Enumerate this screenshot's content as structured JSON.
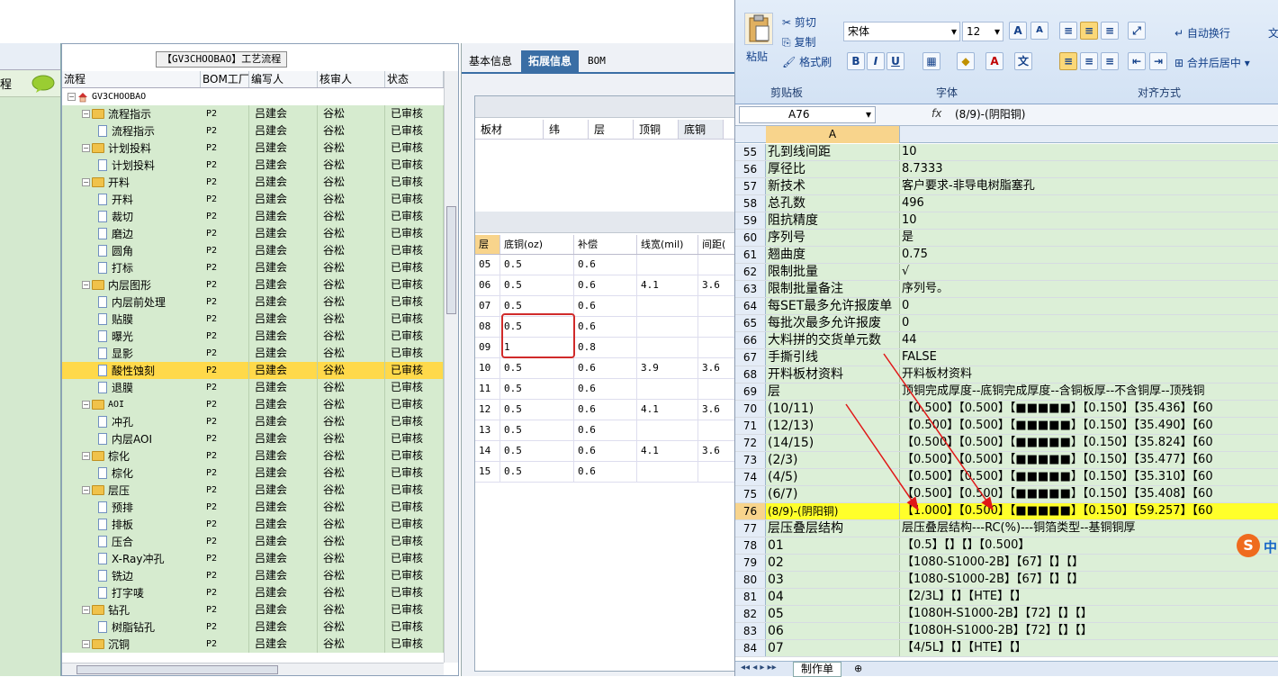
{
  "left_strip": {
    "label": "程"
  },
  "tree": {
    "title": "【GV3CHOOBAO】工艺流程",
    "columns": [
      "流程",
      "BOM工厂",
      "编写人",
      "核审人",
      "状态"
    ],
    "root": "GV3CHOOBAO",
    "rows": [
      {
        "name": "流程指示",
        "level": 1,
        "type": "folder",
        "factory": "P2",
        "author": "吕建会",
        "reviewer": "谷松",
        "status": "已审核"
      },
      {
        "name": "流程指示",
        "level": 2,
        "type": "doc",
        "factory": "P2",
        "author": "吕建会",
        "reviewer": "谷松",
        "status": "已审核"
      },
      {
        "name": "计划投料",
        "level": 1,
        "type": "folder",
        "factory": "P2",
        "author": "吕建会",
        "reviewer": "谷松",
        "status": "已审核"
      },
      {
        "name": "计划投料",
        "level": 2,
        "type": "doc",
        "factory": "P2",
        "author": "吕建会",
        "reviewer": "谷松",
        "status": "已审核"
      },
      {
        "name": "开料",
        "level": 1,
        "type": "folder",
        "factory": "P2",
        "author": "吕建会",
        "reviewer": "谷松",
        "status": "已审核"
      },
      {
        "name": "开料",
        "level": 2,
        "type": "doc",
        "factory": "P2",
        "author": "吕建会",
        "reviewer": "谷松",
        "status": "已审核"
      },
      {
        "name": "裁切",
        "level": 2,
        "type": "doc",
        "factory": "P2",
        "author": "吕建会",
        "reviewer": "谷松",
        "status": "已审核"
      },
      {
        "name": "磨边",
        "level": 2,
        "type": "doc",
        "factory": "P2",
        "author": "吕建会",
        "reviewer": "谷松",
        "status": "已审核"
      },
      {
        "name": "圆角",
        "level": 2,
        "type": "doc",
        "factory": "P2",
        "author": "吕建会",
        "reviewer": "谷松",
        "status": "已审核"
      },
      {
        "name": "打标",
        "level": 2,
        "type": "doc",
        "factory": "P2",
        "author": "吕建会",
        "reviewer": "谷松",
        "status": "已审核"
      },
      {
        "name": "内层图形",
        "level": 1,
        "type": "folder",
        "factory": "P2",
        "author": "吕建会",
        "reviewer": "谷松",
        "status": "已审核"
      },
      {
        "name": "内层前处理",
        "level": 2,
        "type": "doc",
        "factory": "P2",
        "author": "吕建会",
        "reviewer": "谷松",
        "status": "已审核"
      },
      {
        "name": "贴膜",
        "level": 2,
        "type": "doc",
        "factory": "P2",
        "author": "吕建会",
        "reviewer": "谷松",
        "status": "已审核"
      },
      {
        "name": "曝光",
        "level": 2,
        "type": "doc",
        "factory": "P2",
        "author": "吕建会",
        "reviewer": "谷松",
        "status": "已审核"
      },
      {
        "name": "显影",
        "level": 2,
        "type": "doc",
        "factory": "P2",
        "author": "吕建会",
        "reviewer": "谷松",
        "status": "已审核"
      },
      {
        "name": "酸性蚀刻",
        "level": 2,
        "type": "doc",
        "factory": "P2",
        "author": "吕建会",
        "reviewer": "谷松",
        "status": "已审核",
        "selected": true
      },
      {
        "name": "退膜",
        "level": 2,
        "type": "doc",
        "factory": "P2",
        "author": "吕建会",
        "reviewer": "谷松",
        "status": "已审核"
      },
      {
        "name": "AOI",
        "level": 1,
        "type": "folder",
        "factory": "P2",
        "author": "吕建会",
        "reviewer": "谷松",
        "status": "已审核"
      },
      {
        "name": "冲孔",
        "level": 2,
        "type": "doc",
        "factory": "P2",
        "author": "吕建会",
        "reviewer": "谷松",
        "status": "已审核"
      },
      {
        "name": "内层AOI",
        "level": 2,
        "type": "doc",
        "factory": "P2",
        "author": "吕建会",
        "reviewer": "谷松",
        "status": "已审核"
      },
      {
        "name": "棕化",
        "level": 1,
        "type": "folder",
        "factory": "P2",
        "author": "吕建会",
        "reviewer": "谷松",
        "status": "已审核"
      },
      {
        "name": "棕化",
        "level": 2,
        "type": "doc",
        "factory": "P2",
        "author": "吕建会",
        "reviewer": "谷松",
        "status": "已审核"
      },
      {
        "name": "层压",
        "level": 1,
        "type": "folder",
        "factory": "P2",
        "author": "吕建会",
        "reviewer": "谷松",
        "status": "已审核"
      },
      {
        "name": "预排",
        "level": 2,
        "type": "doc",
        "factory": "P2",
        "author": "吕建会",
        "reviewer": "谷松",
        "status": "已审核"
      },
      {
        "name": "排板",
        "level": 2,
        "type": "doc",
        "factory": "P2",
        "author": "吕建会",
        "reviewer": "谷松",
        "status": "已审核"
      },
      {
        "name": "压合",
        "level": 2,
        "type": "doc",
        "factory": "P2",
        "author": "吕建会",
        "reviewer": "谷松",
        "status": "已审核"
      },
      {
        "name": "X-Ray冲孔",
        "level": 2,
        "type": "doc",
        "factory": "P2",
        "author": "吕建会",
        "reviewer": "谷松",
        "status": "已审核"
      },
      {
        "name": "铣边",
        "level": 2,
        "type": "doc",
        "factory": "P2",
        "author": "吕建会",
        "reviewer": "谷松",
        "status": "已审核"
      },
      {
        "name": "打字唛",
        "level": 2,
        "type": "doc",
        "factory": "P2",
        "author": "吕建会",
        "reviewer": "谷松",
        "status": "已审核"
      },
      {
        "name": "钻孔",
        "level": 1,
        "type": "folder",
        "factory": "P2",
        "author": "吕建会",
        "reviewer": "谷松",
        "status": "已审核"
      },
      {
        "name": "树脂钻孔",
        "level": 2,
        "type": "doc",
        "factory": "P2",
        "author": "吕建会",
        "reviewer": "谷松",
        "status": "已审核"
      },
      {
        "name": "沉铜",
        "level": 1,
        "type": "folder",
        "factory": "P2",
        "author": "吕建会",
        "reviewer": "谷松",
        "status": "已审核"
      }
    ]
  },
  "mid": {
    "tabs": [
      "基本信息",
      "拓展信息",
      "BOM"
    ],
    "active_tab": 1,
    "board_columns": [
      "板材",
      "纬",
      "层",
      "顶铜",
      "底铜"
    ],
    "layer_columns": [
      "层",
      "底铜(oz)",
      "补偿",
      "线宽(mil)",
      "间距("
    ],
    "layer_rows": [
      [
        "05",
        "0.5",
        "0.6",
        "",
        ""
      ],
      [
        "06",
        "0.5",
        "0.6",
        "4.1",
        "3.6"
      ],
      [
        "07",
        "0.5",
        "0.6",
        "",
        ""
      ],
      [
        "08",
        "0.5",
        "0.6",
        "",
        ""
      ],
      [
        "09",
        "1",
        "0.8",
        "",
        ""
      ],
      [
        "10",
        "0.5",
        "0.6",
        "3.9",
        "3.6"
      ],
      [
        "11",
        "0.5",
        "0.6",
        "",
        ""
      ],
      [
        "12",
        "0.5",
        "0.6",
        "4.1",
        "3.6"
      ],
      [
        "13",
        "0.5",
        "0.6",
        "",
        ""
      ],
      [
        "14",
        "0.5",
        "0.6",
        "4.1",
        "3.6"
      ],
      [
        "15",
        "0.5",
        "0.6",
        "",
        ""
      ]
    ]
  },
  "excel": {
    "ribbon": {
      "paste": "粘贴",
      "cut": "剪切",
      "copy": "复制",
      "format_painter": "格式刷",
      "clipboard": "剪贴板",
      "font_name": "宋体",
      "font_size": "12",
      "font_group": "字体",
      "wrap": "自动换行",
      "merge": "合并后居中",
      "align_group": "对齐方式",
      "bold": "B",
      "italic": "I",
      "underline": "U",
      "grow": "A",
      "shrink": "A",
      "right_cut": "文"
    },
    "name_box": "A76",
    "fx": "fx",
    "formula": "(8/9)-(阴阳铜)",
    "col_a": "A",
    "rows": [
      {
        "n": "55",
        "a": "孔到线间距",
        "b": "10"
      },
      {
        "n": "56",
        "a": "厚径比",
        "b": "8.7333"
      },
      {
        "n": "57",
        "a": "新技术",
        "b": "客户要求-非导电树脂塞孔"
      },
      {
        "n": "58",
        "a": "总孔数",
        "b": "496"
      },
      {
        "n": "59",
        "a": "阻抗精度",
        "b": "10"
      },
      {
        "n": "60",
        "a": "序列号",
        "b": "是"
      },
      {
        "n": "61",
        "a": "翘曲度",
        "b": "0.75"
      },
      {
        "n": "62",
        "a": "限制批量",
        "b": "√"
      },
      {
        "n": "63",
        "a": "限制批量备注",
        "b": "序列号。"
      },
      {
        "n": "64",
        "a": "每SET最多允许报废单",
        "b": "0"
      },
      {
        "n": "65",
        "a": "每批次最多允许报废",
        "b": "0"
      },
      {
        "n": "66",
        "a": "大料拼的交货单元数",
        "b": "44"
      },
      {
        "n": "67",
        "a": "手撕引线",
        "b": "FALSE"
      },
      {
        "n": "68",
        "a": "开料板材资料",
        "b": "开料板材资料"
      },
      {
        "n": "69",
        "a": "层",
        "b": "顶铜完成厚度--底铜完成厚度--含铜板厚--不含铜厚--顶残铜"
      },
      {
        "n": "70",
        "a": "(10/11)",
        "b": "【0.500】【0.500】【■■■■■】【0.150】【35.436】【60"
      },
      {
        "n": "71",
        "a": "(12/13)",
        "b": "【0.500】【0.500】【■■■■■】【0.150】【35.490】【60"
      },
      {
        "n": "72",
        "a": "(14/15)",
        "b": "【0.500】【0.500】【■■■■■】【0.150】【35.824】【60"
      },
      {
        "n": "73",
        "a": "(2/3)",
        "b": "【0.500】【0.500】【■■■■■】【0.150】【35.477】【60"
      },
      {
        "n": "74",
        "a": "(4/5)",
        "b": "【0.500】【0.500】【■■■■■】【0.150】【35.310】【60"
      },
      {
        "n": "75",
        "a": "(6/7)",
        "b": "【0.500】【0.500】【■■■■■】【0.150】【35.408】【60"
      },
      {
        "n": "76",
        "a": "(8/9)-(阴阳铜)",
        "b": "【1.000】【0.500】【■■■■■】【0.150】【59.257】【60",
        "selected": true
      },
      {
        "n": "77",
        "a": "层压叠层结构",
        "b": "层压叠层结构---RC(%)---铜箔类型--基铜铜厚"
      },
      {
        "n": "78",
        "a": "01",
        "b": "【0.5】【】【】【0.500】"
      },
      {
        "n": "79",
        "a": "02",
        "b": "【1080-S1000-2B】【67】【】【】"
      },
      {
        "n": "80",
        "a": "03",
        "b": "【1080-S1000-2B】【67】【】【】"
      },
      {
        "n": "81",
        "a": "04",
        "b": "【2/3L】【】【HTE】【】"
      },
      {
        "n": "82",
        "a": "05",
        "b": "【1080H-S1000-2B】【72】【】【】"
      },
      {
        "n": "83",
        "a": "06",
        "b": "【1080H-S1000-2B】【72】【】【】"
      },
      {
        "n": "84",
        "a": "07",
        "b": "【4/5L】【】【HTE】【】"
      }
    ],
    "sheet_tab": "制作单",
    "ime": "中"
  }
}
